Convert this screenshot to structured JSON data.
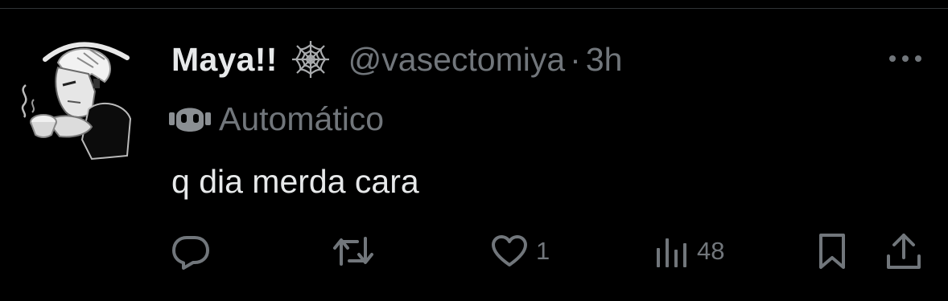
{
  "tweet": {
    "display_name": "Maya!!",
    "badge_icon": "spiderweb-icon",
    "handle": "@vasectomiya",
    "separator": "·",
    "time": "3h",
    "automated_label": "Automático",
    "automated_icon": "bot-icon",
    "text": "q dia merda cara"
  },
  "actions": {
    "reply": {
      "icon": "reply-icon",
      "count": ""
    },
    "retweet": {
      "icon": "retweet-icon",
      "count": ""
    },
    "like": {
      "icon": "heart-icon",
      "count": "1"
    },
    "views": {
      "icon": "views-icon",
      "count": "48"
    },
    "bookmark": {
      "icon": "bookmark-icon"
    },
    "share": {
      "icon": "share-icon"
    }
  },
  "colors": {
    "background": "#000000",
    "primary_text": "#e7e9ea",
    "secondary_text": "#71767b",
    "divider": "#2f3336"
  }
}
